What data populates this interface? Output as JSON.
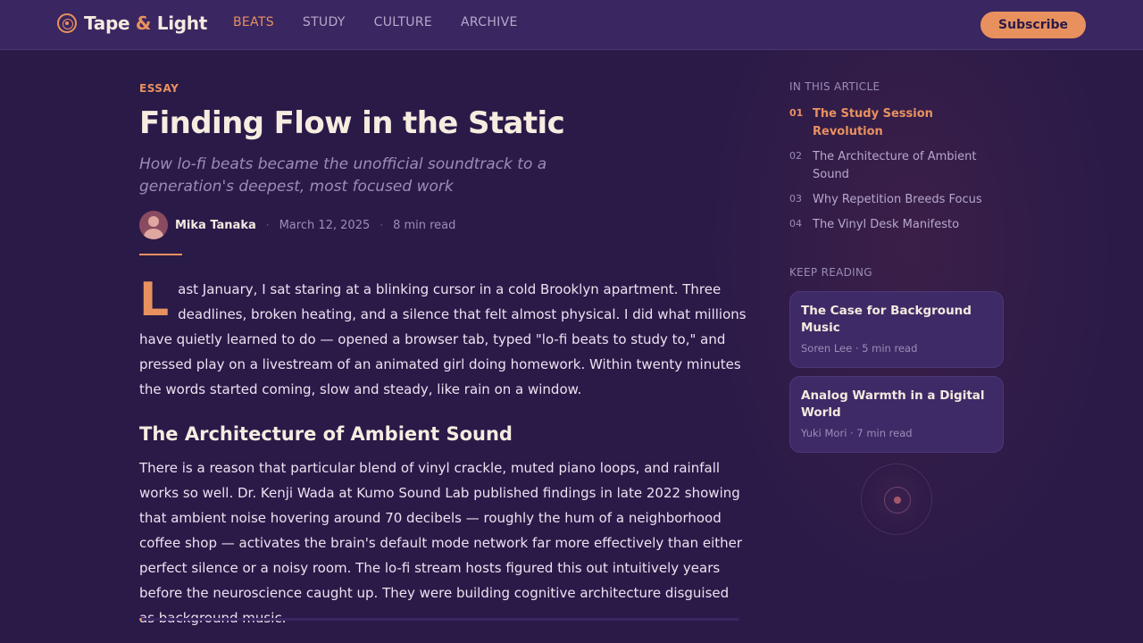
{
  "header": {
    "brand_main": "Tape",
    "brand_amp": "&",
    "brand_tail": "Light",
    "nav": [
      {
        "label": "BEATS",
        "active": true
      },
      {
        "label": "STUDY",
        "active": false
      },
      {
        "label": "CULTURE",
        "active": false
      },
      {
        "label": "ARCHIVE",
        "active": false
      }
    ],
    "subscribe_label": "Subscribe"
  },
  "article": {
    "kicker": "ESSAY",
    "title": "Finding Flow in the Static",
    "subtitle": "How lo-fi beats became the unofficial soundtrack to a generation's deepest, most focused work",
    "author": "Mika Tanaka",
    "date": "March 12, 2025",
    "read_time": "8 min read",
    "dropcap": "L",
    "intro": "ast January, I sat staring at a blinking cursor in a cold Brooklyn apartment. Three deadlines, broken heating, and a silence that felt almost physical. I did what millions have quietly learned to do — opened a browser tab, typed \"lo-fi beats to study to,\" and pressed play on a livestream of an animated girl doing homework. Within twenty minutes the words started coming, slow and steady, like rain on a window.",
    "section_heading": "The Architecture of Ambient Sound",
    "section_body": "There is a reason that particular blend of vinyl crackle, muted piano loops, and rainfall works so well. Dr. Kenji Wada at Kumo Sound Lab published findings in late 2022 showing that ambient noise hovering around 70 decibels — roughly the hum of a neighborhood coffee shop — activates the brain's default mode network far more effectively than either perfect silence or a noisy room. The lo-fi stream hosts figured this out intuitively years before the neuroscience caught up. They were building cognitive architecture disguised as background music.",
    "read_progress": 0.005
  },
  "sidebar": {
    "toc_label": "IN THIS ARTICLE",
    "toc": [
      {
        "num": "01",
        "title": "The Study Session Revolution",
        "active": true
      },
      {
        "num": "02",
        "title": "The Architecture of Ambient Sound",
        "active": false
      },
      {
        "num": "03",
        "title": "Why Repetition Breeds Focus",
        "active": false
      },
      {
        "num": "04",
        "title": "The Vinyl Desk Manifesto",
        "active": false
      }
    ],
    "keep_reading_label": "KEEP READING",
    "cards": [
      {
        "title": "The Case for Background Music",
        "meta": "Soren Lee · 5 min read"
      },
      {
        "title": "Analog Warmth in a Digital World",
        "meta": "Yuki Mori · 7 min read"
      }
    ]
  },
  "colors": {
    "accent": "#e8915f",
    "background": "#2a1a48",
    "topbar": "#3a2660"
  }
}
